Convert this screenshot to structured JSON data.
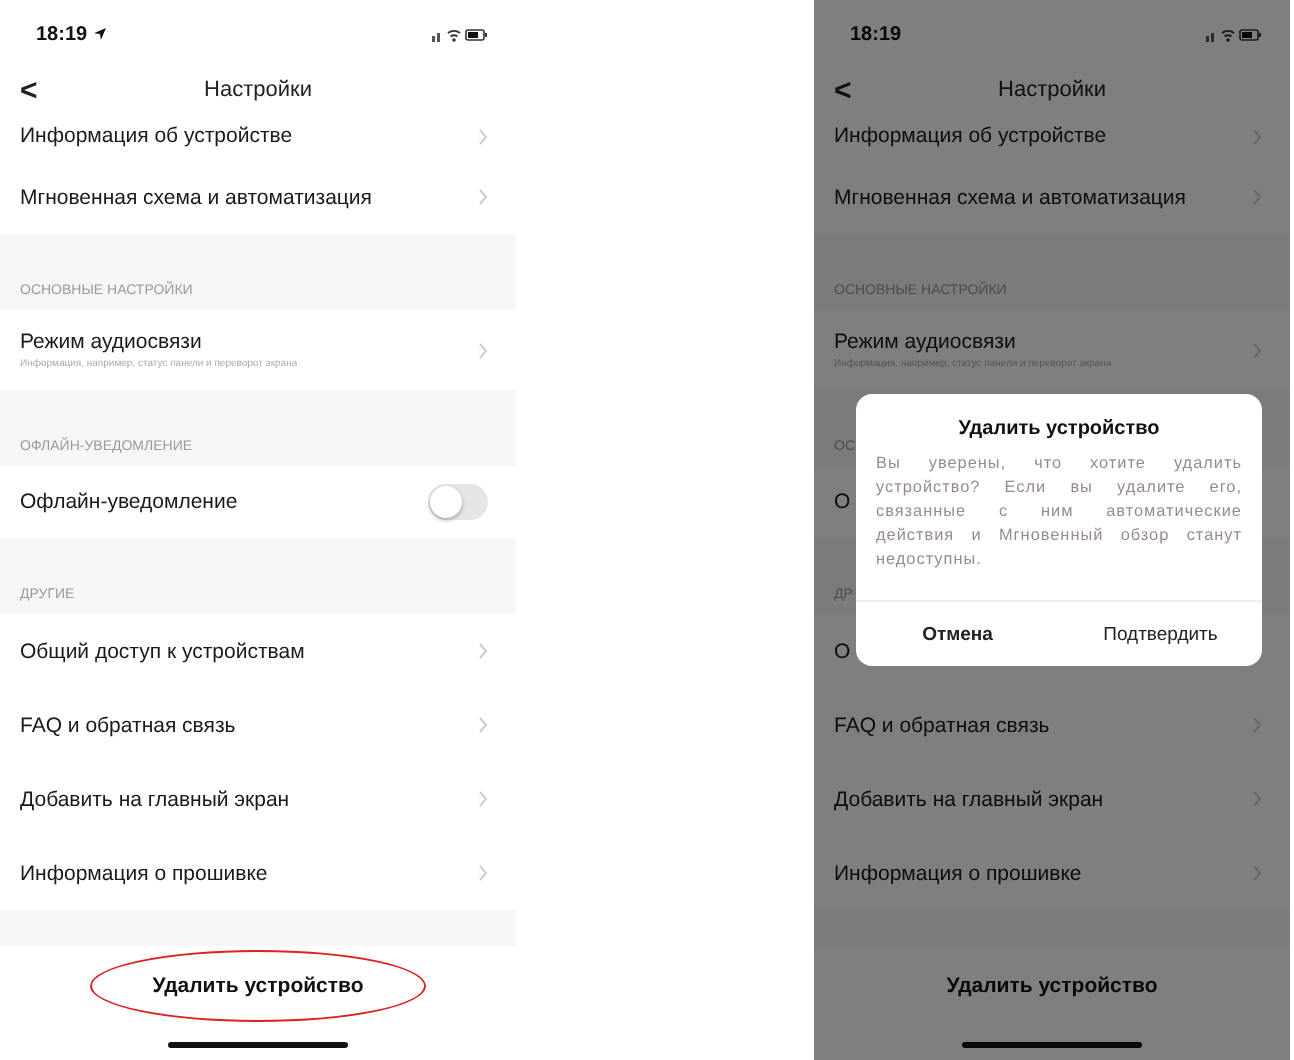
{
  "screens": [
    {
      "status_time": "18:19",
      "location_on": true,
      "title": "Настройки",
      "back": "<",
      "items": [
        {
          "kind": "row",
          "label": "Информация об устройстве"
        },
        {
          "kind": "row",
          "label": "Мгновенная схема и автоматизация"
        },
        {
          "kind": "section",
          "label": "ОСНОВНЫЕ НАСТРОЙКИ"
        },
        {
          "kind": "row",
          "label": "Режим аудиосвязи",
          "subtitle": "Информация, например, статус панели и переворот экрана"
        },
        {
          "kind": "section",
          "label": "ОФЛАЙН-УВЕДОМЛЕНИЕ"
        },
        {
          "kind": "toggle",
          "label": "Офлайн-уведомление",
          "on": false
        },
        {
          "kind": "section",
          "label": "ДРУГИЕ"
        },
        {
          "kind": "row",
          "label": "Общий доступ к устройствам"
        },
        {
          "kind": "row",
          "label": "FAQ и обратная связь"
        },
        {
          "kind": "row",
          "label": "Добавить на главный экран"
        },
        {
          "kind": "row",
          "label": "Информация о прошивке"
        }
      ],
      "delete_button": {
        "label": "Удалить устройство",
        "highlighted": true
      }
    },
    {
      "status_time": "18:19",
      "location_on": false,
      "title": "Настройки",
      "back": "<",
      "items": [
        {
          "kind": "row",
          "label": "Информация об устройстве"
        },
        {
          "kind": "row",
          "label": "Мгновенная схема и автоматизация"
        },
        {
          "kind": "section",
          "label": "ОСНОВНЫЕ НАСТРОЙКИ"
        },
        {
          "kind": "row",
          "label": "Режим аудиосвязи",
          "subtitle": "Информация, например, статус панели и переворот экрана"
        },
        {
          "kind": "section",
          "label": "ОС"
        },
        {
          "kind": "toggle",
          "label": "О"
        },
        {
          "kind": "section",
          "label": "ДР"
        },
        {
          "kind": "row",
          "label": "О"
        },
        {
          "kind": "row",
          "label": "FAQ и обратная связь"
        },
        {
          "kind": "row",
          "label": "Добавить на главный экран"
        },
        {
          "kind": "row",
          "label": "Информация о прошивке"
        }
      ],
      "delete_button": {
        "label": "Удалить устройство",
        "highlighted": false
      },
      "dialog": {
        "title": "Удалить устройство",
        "message": "Вы уверены, что хотите удалить устройство? Если вы удалите его, связанные с ним автоматические действия и Мгновенный обзор станут недоступны.",
        "buttons": [
          {
            "label": "Отмена",
            "kind": "cancel"
          },
          {
            "label": "Подтвердить",
            "kind": "confirm"
          }
        ]
      }
    }
  ]
}
